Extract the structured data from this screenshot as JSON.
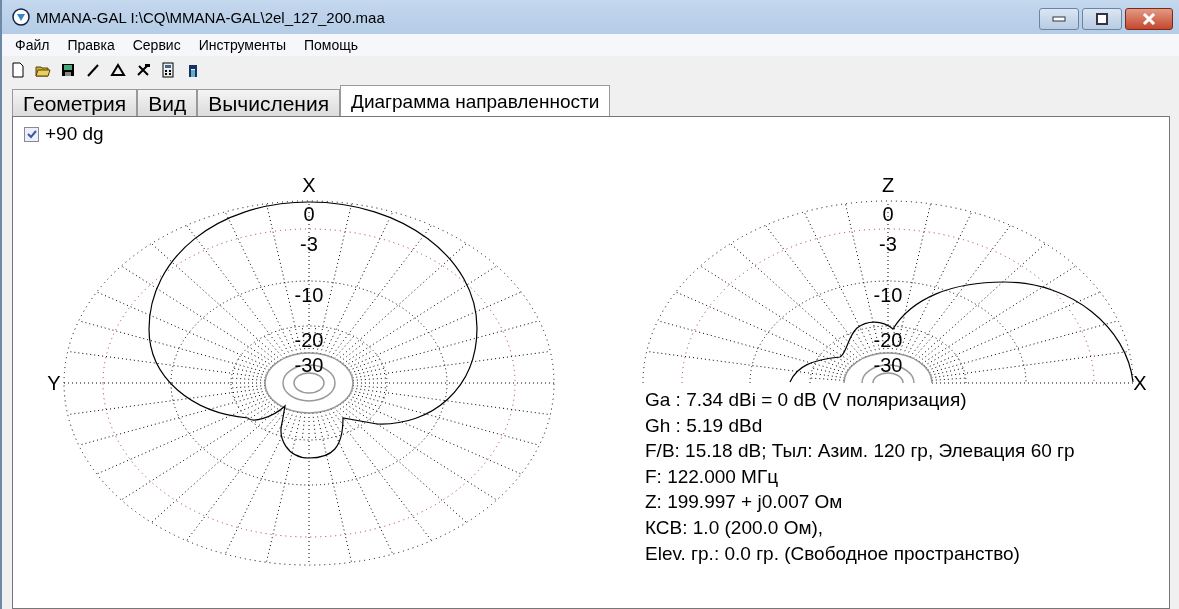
{
  "window": {
    "title": "MMANA-GAL I:\\CQ\\MMANA-GAL\\2el_127_200.maa"
  },
  "menu": [
    "Файл",
    "Правка",
    "Сервис",
    "Инструменты",
    "Помощь"
  ],
  "toolbar": [
    {
      "kind": "new"
    },
    {
      "kind": "open"
    },
    {
      "kind": "save"
    },
    {
      "kind": "line"
    },
    {
      "kind": "triangle"
    },
    {
      "kind": "tools"
    },
    {
      "kind": "calculator"
    },
    {
      "kind": "gate"
    }
  ],
  "tabs": [
    {
      "label": "Геометрия",
      "selected": false
    },
    {
      "label": "Вид",
      "selected": false
    },
    {
      "label": "Вычисления",
      "selected": false
    },
    {
      "label": "Диаграмма направленности",
      "selected": true
    }
  ],
  "option": {
    "label": "+90 dg",
    "checked": true
  },
  "plots": [
    {
      "kind": "full",
      "axis_top": "X",
      "axis_side": "Y",
      "ring_labels": [
        "0",
        "-3",
        "-10",
        "-20",
        "-30"
      ]
    },
    {
      "kind": "half",
      "axis_top": "Z",
      "axis_side": "X",
      "ring_labels": [
        "0",
        "-3",
        "-10",
        "-20",
        "-30"
      ]
    }
  ],
  "info": [
    "Ga : 7.34 dBi = 0 dB  (V поляризация)",
    "Gh : 5.19 dBd",
    "F/B: 15.18 dB; Тыл: Азим. 120 гр, Элевация 60 гр",
    "F: 122.000 МГц",
    "Z: 199.997 + j0.007 Ом",
    "КСВ: 1.0 (200.0 Ом),",
    "Elev. гр.: 0.0 гр. (Свободное пространство)"
  ]
}
